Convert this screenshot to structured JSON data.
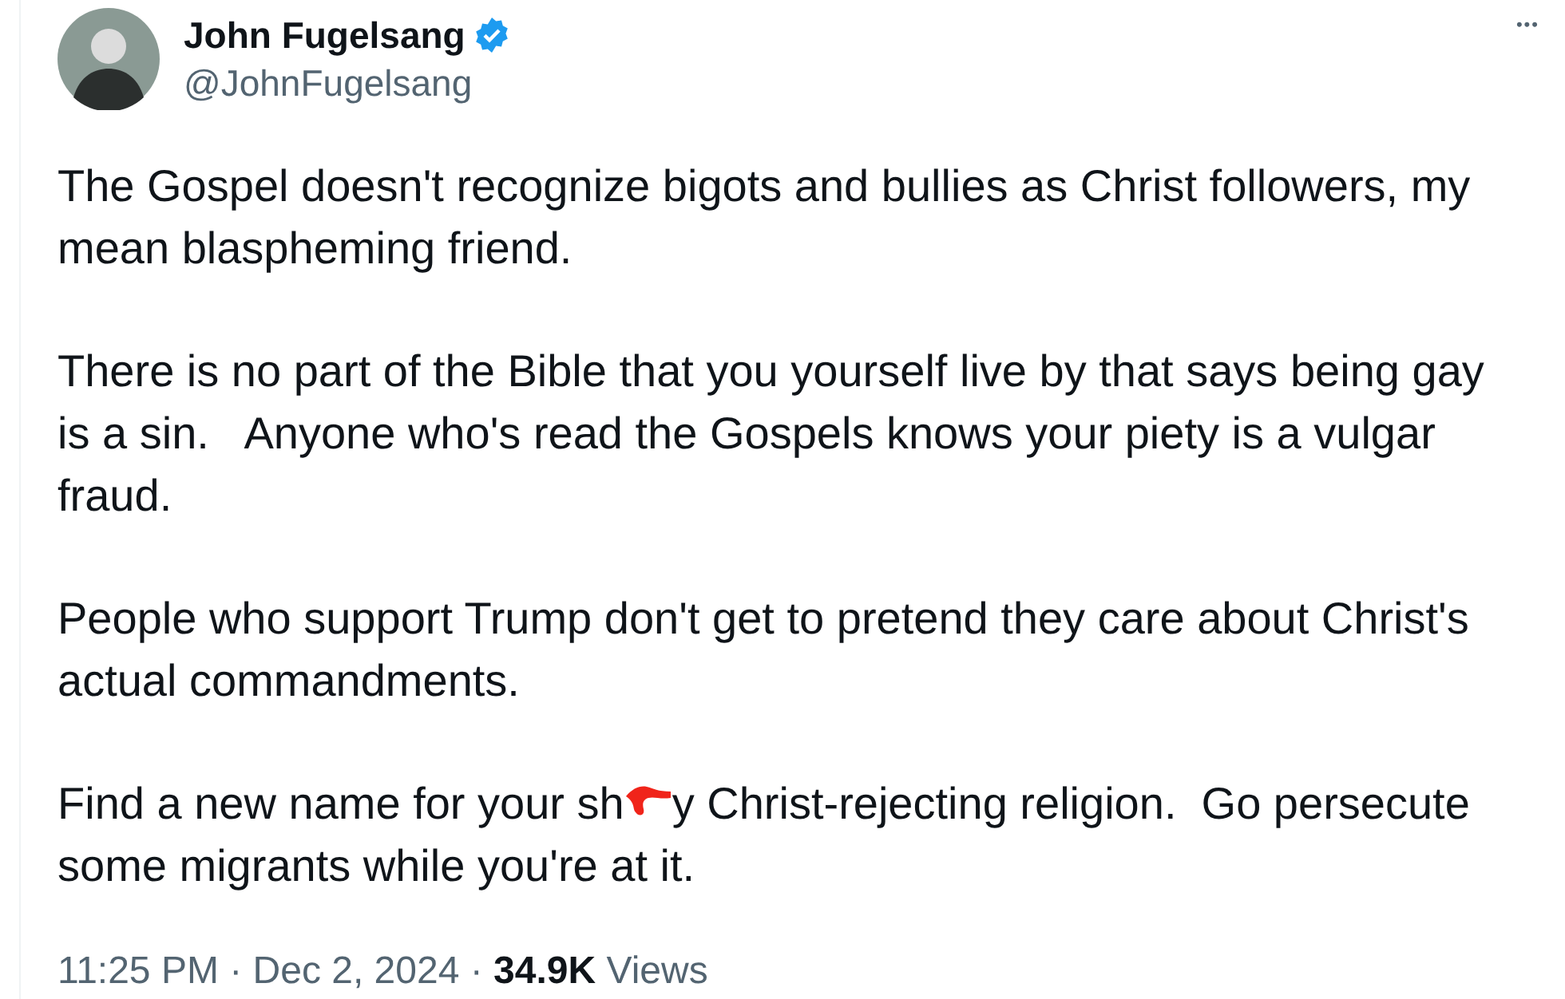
{
  "author": {
    "name": "John Fugelsang",
    "verified": true,
    "handle": "@JohnFugelsang"
  },
  "more_button": "•••",
  "paragraphs": [
    {
      "kind": "text",
      "text": "The Gospel doesn't recognize bigots and bullies as Christ followers, my mean blaspheming friend."
    },
    {
      "kind": "text",
      "text": "There is no part of the Bible that you yourself live by that says being gay is a sin.   Anyone who's read the Gospels knows your piety is a vulgar fraud."
    },
    {
      "kind": "text",
      "text": "People who support Trump don't get to pretend they care about Christ's actual commandments."
    },
    {
      "kind": "scribbled",
      "before": "Find a new name for your sh",
      "after": "y Christ-rejecting religion.  Go persecute some migrants while you're at it."
    }
  ],
  "meta": "11:25 PM · Dec 2, 2024 · **34.9K** Views"
}
